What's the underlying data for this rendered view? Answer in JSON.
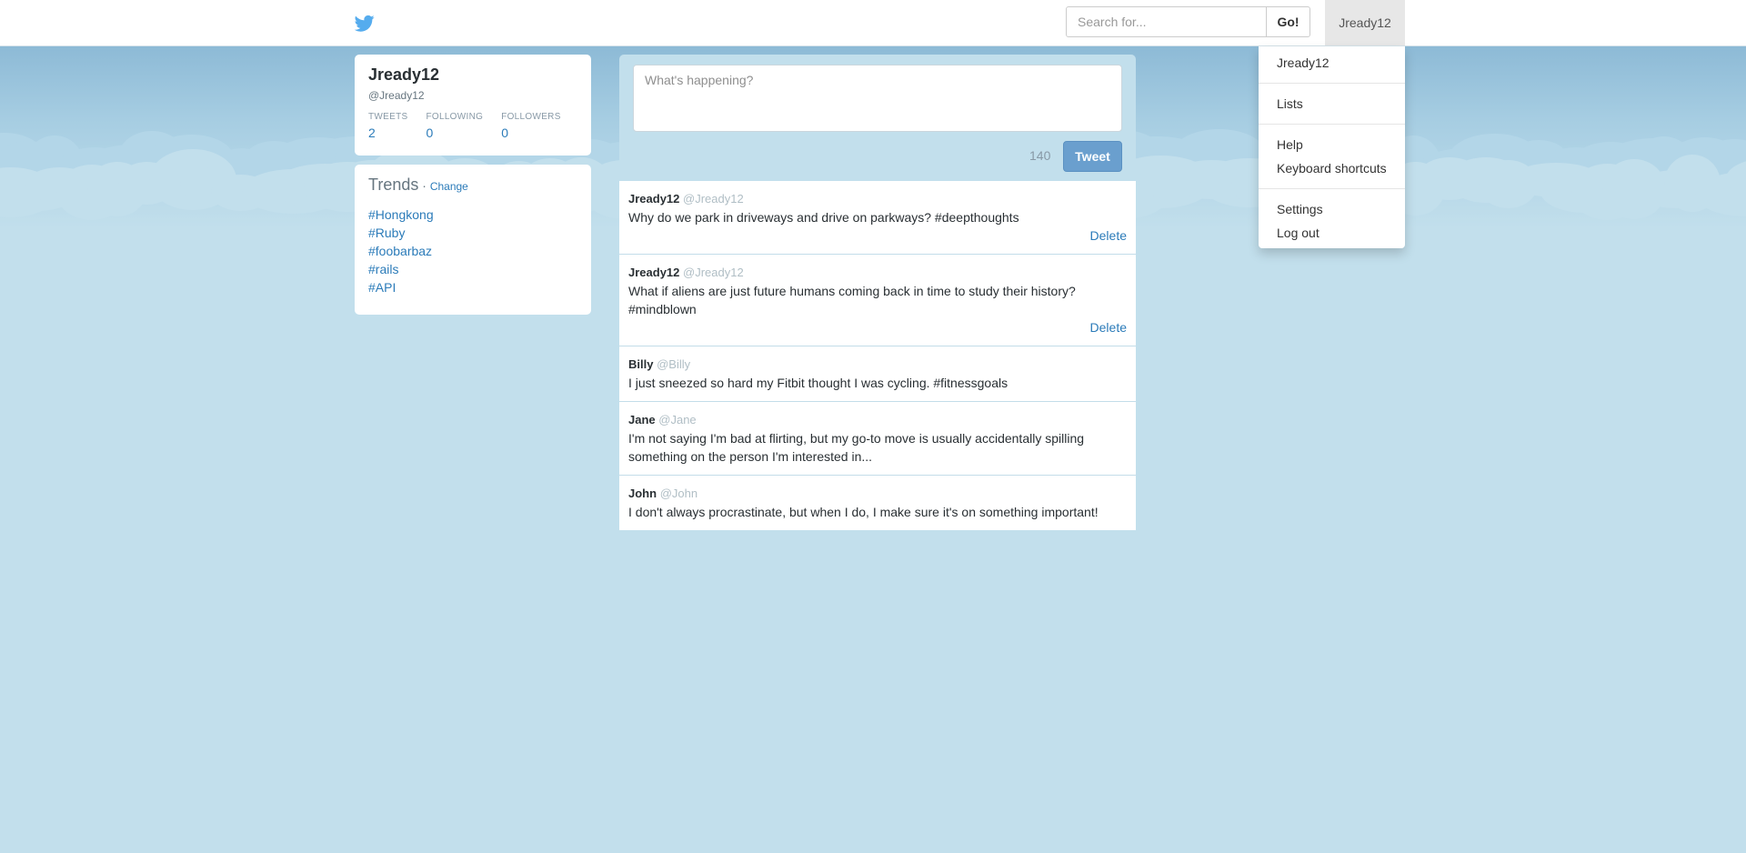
{
  "navbar": {
    "search_placeholder": "Search for...",
    "go_label": "Go!",
    "user_label": "Jready12"
  },
  "dropdown": {
    "items": [
      "Jready12",
      "Lists",
      "Help",
      "Keyboard shortcuts",
      "Settings",
      "Log out"
    ]
  },
  "profile": {
    "name": "Jready12",
    "handle": "@Jready12",
    "stats": [
      {
        "label": "TWEETS",
        "value": "2"
      },
      {
        "label": "FOLLOWING",
        "value": "0"
      },
      {
        "label": "FOLLOWERS",
        "value": "0"
      }
    ]
  },
  "trends": {
    "title": "Trends",
    "separator": "·",
    "change_label": "Change",
    "items": [
      "#Hongkong",
      "#Ruby",
      "#foobarbaz",
      "#rails",
      "#API"
    ]
  },
  "compose": {
    "placeholder": "What's happening?",
    "char_count": "140",
    "tweet_label": "Tweet"
  },
  "feed": {
    "tweets": [
      {
        "name": "Jready12",
        "handle": "@Jready12",
        "text": "Why do we park in driveways and drive on parkways? #deepthoughts",
        "delete_label": "Delete"
      },
      {
        "name": "Jready12",
        "handle": "@Jready12",
        "text": "What if aliens are just future humans coming back in time to study their history? #mindblown",
        "delete_label": "Delete"
      },
      {
        "name": "Billy",
        "handle": "@Billy",
        "text": "I just sneezed so hard my Fitbit thought I was cycling. #fitnessgoals"
      },
      {
        "name": "Jane",
        "handle": "@Jane",
        "text": "I'm not saying I'm bad at flirting, but my go-to move is usually accidentally spilling something on the person I'm interested in..."
      },
      {
        "name": "John",
        "handle": "@John",
        "text": "I don't always procrastinate, but when I do, I make sure it's on something important!"
      }
    ]
  },
  "colors": {
    "accent": "#2b7bb9",
    "tweet_button": "#6a9fce",
    "background": "#c2dfec",
    "bird": "#55acee"
  },
  "icons": {
    "logo": "twitter-bird-icon"
  }
}
